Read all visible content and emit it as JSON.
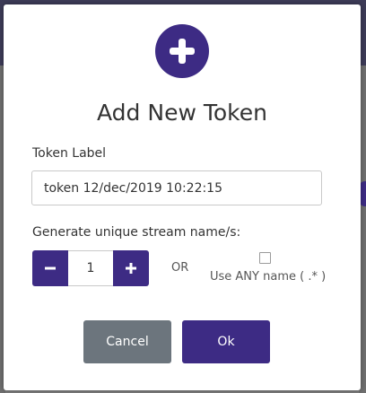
{
  "modal": {
    "title": "Add New Token",
    "token_label": "Token Label",
    "token_value": "token 12/dec/2019 10:22:15",
    "generate_label": "Generate unique stream name/s:",
    "stepper_value": "1",
    "or_text": "OR",
    "any_name_label": "Use ANY name ( .* )",
    "any_name_checked": false,
    "cancel_label": "Cancel",
    "ok_label": "Ok"
  },
  "colors": {
    "accent": "#3d2b84",
    "cancel": "#6c757d",
    "text": "#333333"
  },
  "icons": {
    "header": "plus-circle-icon",
    "decrement": "minus-icon",
    "increment": "plus-icon"
  }
}
